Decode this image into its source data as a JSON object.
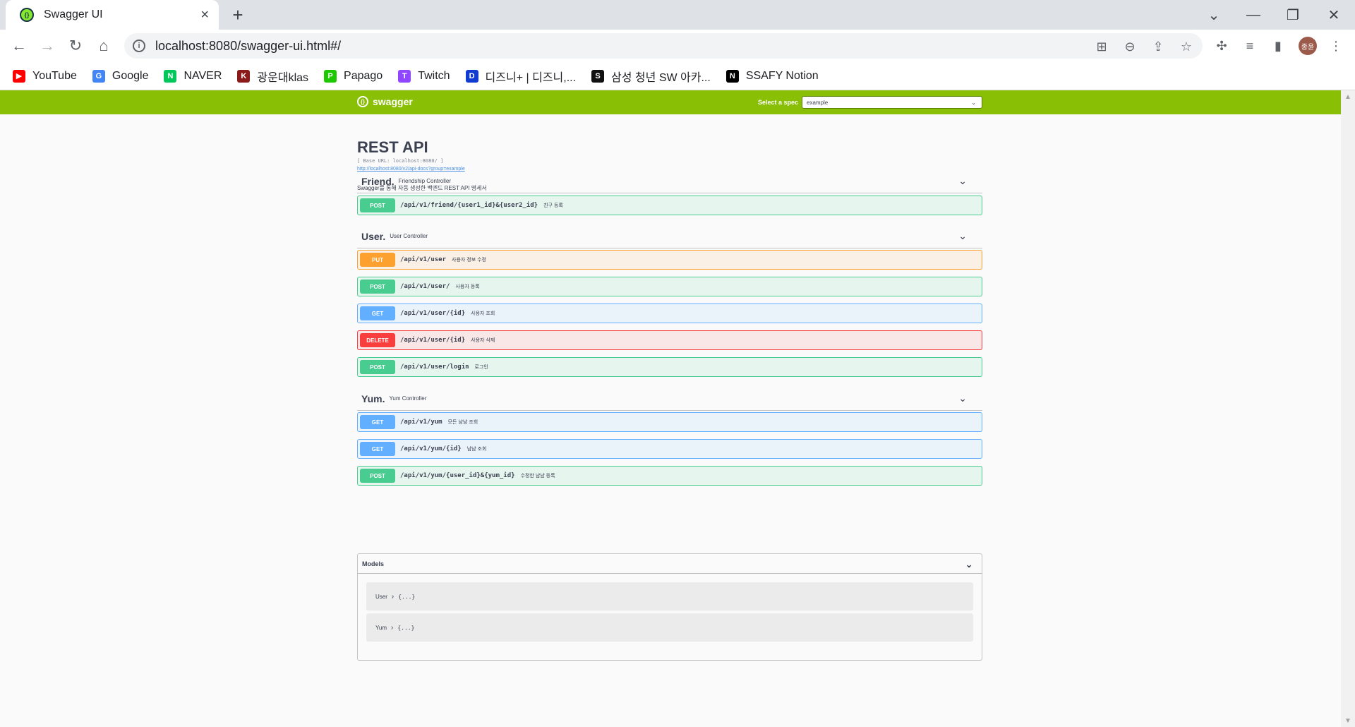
{
  "browser": {
    "tab_title": "Swagger UI",
    "tab_close": "×",
    "new_tab": "+",
    "url": "localhost:8080/swagger-ui.html#/",
    "window_controls": [
      "⌄",
      "—",
      "❐",
      "✕"
    ],
    "avatar_text": "종윤",
    "bookmarks": [
      {
        "label": "YouTube",
        "icon": "youtube-icon",
        "color": "#ff0000",
        "glyph": "▶"
      },
      {
        "label": "Google",
        "icon": "google-icon",
        "color": "#4285f4",
        "glyph": "G"
      },
      {
        "label": "NAVER",
        "icon": "naver-icon",
        "color": "#03c75a",
        "glyph": "N"
      },
      {
        "label": "광운대klas",
        "icon": "kw-icon",
        "color": "#8b1a1a",
        "glyph": "K"
      },
      {
        "label": "Papago",
        "icon": "papago-icon",
        "color": "#1ec800",
        "glyph": "P"
      },
      {
        "label": "Twitch",
        "icon": "twitch-icon",
        "color": "#9146ff",
        "glyph": "T"
      },
      {
        "label": "디즈니+ | 디즈니,...",
        "icon": "disney-icon",
        "color": "#113ccf",
        "glyph": "D"
      },
      {
        "label": "삼성 청년 SW 아카...",
        "icon": "samsung-icon",
        "color": "#111111",
        "glyph": "S"
      },
      {
        "label": "SSAFY Notion",
        "icon": "notion-icon",
        "color": "#000000",
        "glyph": "N"
      }
    ]
  },
  "swagger": {
    "logo_text": "swagger",
    "spec_label": "Select a spec",
    "spec_value": "example",
    "title": "REST API",
    "base_url": "[ Base URL: localhost:8080/ ]",
    "doc_link": "http://localhost:8080/v2/api-docs?group=example",
    "description": "Swagger를 통해 자동 생성한 백엔드 REST API 명세서",
    "tags": [
      {
        "name": "Friend.",
        "desc": "Friendship Controller",
        "ops": [
          {
            "method": "POST",
            "path": "/api/v1/friend/{user1_id}&{user2_id}",
            "summary": "친구 등록"
          }
        ]
      },
      {
        "name": "User.",
        "desc": "User Controller",
        "ops": [
          {
            "method": "PUT",
            "path": "/api/v1/user",
            "summary": "사용자 정보 수정"
          },
          {
            "method": "POST",
            "path": "/api/v1/user/",
            "summary": "사용자 등록"
          },
          {
            "method": "GET",
            "path": "/api/v1/user/{id}",
            "summary": "사용자 조회"
          },
          {
            "method": "DELETE",
            "path": "/api/v1/user/{id}",
            "summary": "사용자 삭제"
          },
          {
            "method": "POST",
            "path": "/api/v1/user/login",
            "summary": "로그인"
          }
        ]
      },
      {
        "name": "Yum.",
        "desc": "Yum Controller",
        "ops": [
          {
            "method": "GET",
            "path": "/api/v1/yum",
            "summary": "모든 냠냠 조회"
          },
          {
            "method": "GET",
            "path": "/api/v1/yum/{id}",
            "summary": "냠냠 조회"
          },
          {
            "method": "POST",
            "path": "/api/v1/yum/{user_id}&{yum_id}",
            "summary": "수정한 냠냠 등록"
          }
        ]
      }
    ],
    "models_title": "Models",
    "models": [
      {
        "name": "User",
        "braces": "{...}"
      },
      {
        "name": "Yum",
        "braces": "{...}"
      }
    ]
  }
}
